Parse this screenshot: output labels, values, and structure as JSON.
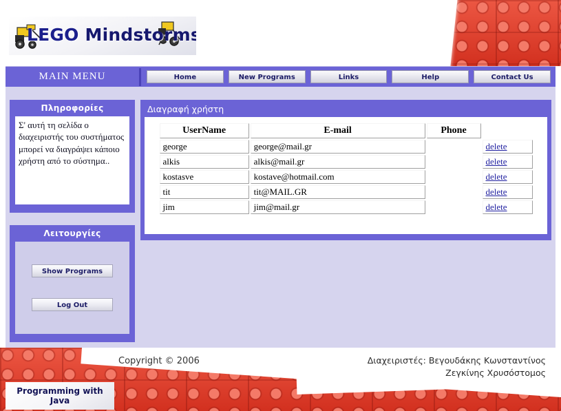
{
  "header": {
    "logo_text_lego": "LEGO",
    "logo_text_rest": " Mindstorms",
    "robot_left_icon": "lego-robot-icon",
    "robot_right_icon": "lego-robot-icon"
  },
  "menu": {
    "main_menu_label": "MAIN MENU",
    "items": [
      {
        "label": "Home"
      },
      {
        "label": "New Programs"
      },
      {
        "label": "Links"
      },
      {
        "label": "Help"
      },
      {
        "label": "Contact Us"
      }
    ]
  },
  "sidebar": {
    "info_panel": {
      "title": "Πληροφορίες",
      "text": "Σ' αυτή τη σελίδα ο διαχειριστής του συστήματος μπορεί να διαγράψει κάποιο χρήστη από το σύστημα.."
    },
    "operations_panel": {
      "title": "Λειτουργίες",
      "buttons": [
        {
          "label": "Show Programs"
        },
        {
          "label": "Log Out"
        }
      ]
    }
  },
  "main": {
    "title": "Διαγραφή χρήστη",
    "table": {
      "columns": [
        "UserName",
        "E-mail",
        "Phone",
        ""
      ],
      "action_label": "delete",
      "rows": [
        {
          "username": "george",
          "email": "george@mail.gr",
          "phone": "",
          "action": "delete"
        },
        {
          "username": "alkis",
          "email": "alkis@mail.gr",
          "phone": "",
          "action": "delete"
        },
        {
          "username": "kostasve",
          "email": "kostave@hotmail.com",
          "phone": "",
          "action": "delete"
        },
        {
          "username": "tit",
          "email": "tit@MAIL.GR",
          "phone": "",
          "action": "delete"
        },
        {
          "username": "jim",
          "email": "jim@mail.gr",
          "phone": "",
          "action": "delete"
        }
      ]
    }
  },
  "footer": {
    "copyright": "Copyright © 2006",
    "admins_line1": "Διαχειριστές: Βεγουδάκης Κωνσταντίνος",
    "admins_line2": "Ζεγκίνης Χρυσόστομος",
    "java_line1": "Programming with",
    "java_line2": "Java"
  },
  "colors": {
    "purple": "#6b63d6",
    "page_bg": "#d6d4ee",
    "brick_red": "#e23c2c",
    "link_blue": "#2020a0",
    "button_text": "#1c1c66"
  }
}
